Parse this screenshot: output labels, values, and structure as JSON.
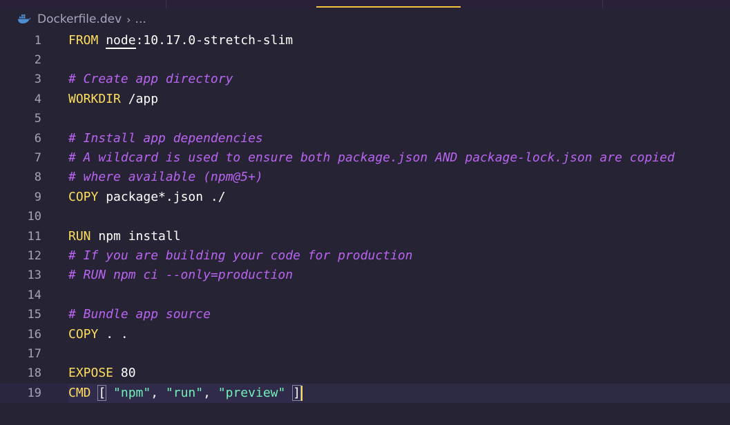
{
  "breadcrumb": {
    "file_icon": "docker-whale-icon",
    "file": "Dockerfile.dev",
    "separator": "›",
    "more": "..."
  },
  "editor": {
    "lines": [
      {
        "num": "1",
        "kind": "from",
        "keyword": "FROM",
        "image": "node",
        "rest": ":10.17.0-stretch-slim"
      },
      {
        "num": "2",
        "kind": "blank"
      },
      {
        "num": "3",
        "kind": "comment",
        "text": "# Create app directory"
      },
      {
        "num": "4",
        "kind": "instr",
        "keyword": "WORKDIR",
        "rest": " /app"
      },
      {
        "num": "5",
        "kind": "blank"
      },
      {
        "num": "6",
        "kind": "comment",
        "text": "# Install app dependencies"
      },
      {
        "num": "7",
        "kind": "comment",
        "text": "# A wildcard is used to ensure both package.json AND package-lock.json are copied"
      },
      {
        "num": "8",
        "kind": "comment",
        "text": "# where available (npm@5+)"
      },
      {
        "num": "9",
        "kind": "instr",
        "keyword": "COPY",
        "rest": " package*.json ./"
      },
      {
        "num": "10",
        "kind": "blank"
      },
      {
        "num": "11",
        "kind": "instr",
        "keyword": "RUN",
        "rest": " npm install"
      },
      {
        "num": "12",
        "kind": "comment",
        "text": "# If you are building your code for production"
      },
      {
        "num": "13",
        "kind": "comment",
        "text": "# RUN npm ci --only=production"
      },
      {
        "num": "14",
        "kind": "blank"
      },
      {
        "num": "15",
        "kind": "comment",
        "text": "# Bundle app source"
      },
      {
        "num": "16",
        "kind": "instr",
        "keyword": "COPY",
        "rest": " . ."
      },
      {
        "num": "17",
        "kind": "blank"
      },
      {
        "num": "18",
        "kind": "instr",
        "keyword": "EXPOSE",
        "rest": " 80"
      },
      {
        "num": "19",
        "kind": "cmd",
        "keyword": "CMD",
        "open": "[",
        "args": [
          "\"npm\"",
          "\"run\"",
          "\"preview\""
        ],
        "sep": ", ",
        "close": "]",
        "current": true
      }
    ]
  },
  "colors": {
    "background": "#262335",
    "keyword": "#fede5d",
    "comment": "#b965f0",
    "string": "#72f1b8",
    "text": "#ffffff",
    "line_number": "#a6a3b8",
    "tab_indicator": "#f0c43c"
  }
}
